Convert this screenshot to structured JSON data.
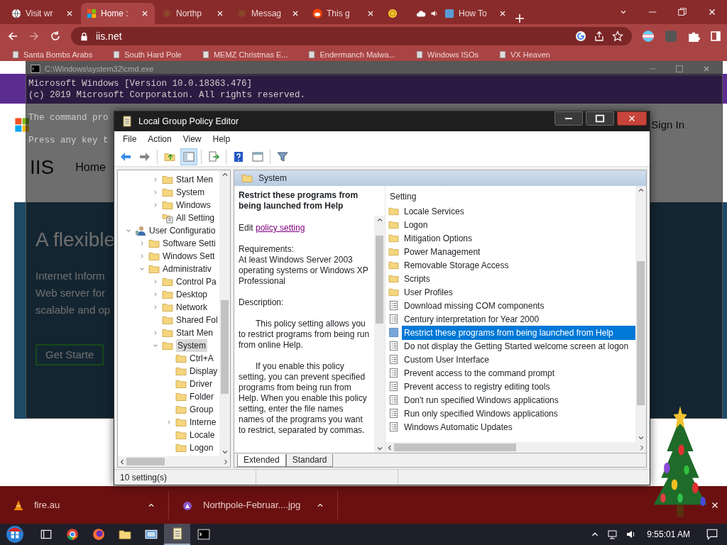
{
  "browser": {
    "tabs": [
      {
        "label": "Visit wr",
        "kind": "globe",
        "selected": false,
        "audio": false
      },
      {
        "label": "Home :",
        "kind": "windows",
        "selected": true,
        "audio": false
      },
      {
        "label": "Northp",
        "kind": "snowflake",
        "selected": false,
        "audio": false
      },
      {
        "label": "Messag",
        "kind": "snowflake",
        "selected": false,
        "audio": false
      },
      {
        "label": "This g",
        "kind": "reddit",
        "selected": false,
        "audio": false
      },
      {
        "kind": "coin",
        "selected": false,
        "audio": false
      },
      {
        "kind": "cloud",
        "selected": false,
        "audio": true
      },
      {
        "label": "How To",
        "kind": "tile",
        "selected": false,
        "audio": false
      }
    ],
    "address": "iis.net",
    "bookmarks": [
      "Santa Bombs Arabs",
      "South Hard Pole",
      "MEMZ Christmas E...",
      "Endermanch Malwa...",
      "Windows ISOs",
      "VX Heaven"
    ],
    "page": {
      "sign_in": "Sign In",
      "logo": "IIS",
      "nav": "Home",
      "hero_title": "A flexible",
      "hero_lines": [
        "Internet Inform",
        "Web server for",
        "scalable and op"
      ],
      "cta": "Get Starte"
    },
    "downloads": [
      {
        "name": "fire.au",
        "kind": "cone"
      },
      {
        "name": "Northpole-Februar....jpg",
        "kind": "image"
      }
    ]
  },
  "cmd": {
    "title": "C:\\Windows\\system32\\cmd.exe",
    "lines": [
      "Microsoft Windows [Version 10.0.18363.476]",
      "(c) 2019 Microsoft Corporation. All rights reserved.",
      "The command pro",
      "Press any key t"
    ]
  },
  "gpe": {
    "title": "Local Group Policy Editor",
    "menu": [
      "File",
      "Action",
      "View",
      "Help"
    ],
    "toolbar": [
      {
        "kind": "back",
        "pressed": false,
        "separator_before": false
      },
      {
        "kind": "forward",
        "pressed": false,
        "separator_before": false
      },
      {
        "kind": "folder-up",
        "pressed": false,
        "separator_before": true
      },
      {
        "kind": "tree-toggle",
        "pressed": true,
        "separator_before": false
      },
      {
        "kind": "export",
        "pressed": false,
        "separator_before": true
      },
      {
        "kind": "help",
        "pressed": false,
        "separator_before": true
      },
      {
        "kind": "view",
        "pressed": false,
        "separator_before": false
      },
      {
        "kind": "filter",
        "pressed": false,
        "separator_before": true
      }
    ],
    "tree": {
      "partial_items": [
        {
          "label": "Start Men",
          "kind": "folder",
          "expanded": false,
          "selected": false
        },
        {
          "label": "System",
          "kind": "folder",
          "expanded": false,
          "selected": false
        },
        {
          "label": "Windows",
          "kind": "folder",
          "expanded": false,
          "selected": false
        },
        {
          "label": "All Setting",
          "kind": "settings",
          "selected": false
        }
      ],
      "items": [
        {
          "label": "User Configuratio",
          "kind": "user",
          "expanded": true,
          "selected": false,
          "children": [
            {
              "label": "Software Setti",
              "kind": "folder",
              "expanded": false,
              "selected": false
            },
            {
              "label": "Windows Sett",
              "kind": "folder",
              "expanded": false,
              "selected": false
            },
            {
              "label": "Administrativ",
              "kind": "folder",
              "expanded": true,
              "selected": false,
              "children": [
                {
                  "label": "Control Pa",
                  "kind": "folder",
                  "expanded": false,
                  "selected": false
                },
                {
                  "label": "Desktop",
                  "kind": "folder",
                  "expanded": false,
                  "selected": false
                },
                {
                  "label": "Network",
                  "kind": "folder",
                  "expanded": false,
                  "selected": false
                },
                {
                  "label": "Shared Fol",
                  "kind": "folder",
                  "selected": false
                },
                {
                  "label": "Start Men",
                  "kind": "folder",
                  "expanded": false,
                  "selected": false
                },
                {
                  "label": "System",
                  "kind": "folder",
                  "expanded": true,
                  "selected": true,
                  "children": [
                    {
                      "label": "Ctrl+A",
                      "kind": "folder",
                      "selected": false
                    },
                    {
                      "label": "Display",
                      "kind": "folder",
                      "selected": false
                    },
                    {
                      "label": "Driver",
                      "kind": "folder",
                      "selected": false
                    },
                    {
                      "label": "Folder",
                      "kind": "folder",
                      "selected": false
                    },
                    {
                      "label": "Group",
                      "kind": "folder",
                      "selected": false
                    },
                    {
                      "label": "Interne",
                      "kind": "folder",
                      "expanded": false,
                      "selected": false
                    },
                    {
                      "label": "Locale",
                      "kind": "folder",
                      "selected": false
                    },
                    {
                      "label": "Logon",
                      "kind": "folder",
                      "selected": false
                    }
                  ]
                }
              ]
            }
          ]
        }
      ]
    },
    "header": "System",
    "description": {
      "title": "Restrict these programs from being launched from Help",
      "edit_prefix": "Edit",
      "edit_link": "policy setting",
      "requirements_label": "Requirements:",
      "requirements": "At least Windows Server 2003 operating systems or Windows XP Professional",
      "description_label": "Description:",
      "paragraphs": [
        "This policy setting allows you to restrict programs from being run from online Help.",
        "If you enable this policy setting, you can prevent specified programs from being run from Help. When you enable this policy setting, enter the file names names of the programs you want to restrict, separated by commas."
      ]
    },
    "list": {
      "column": "Setting",
      "items": [
        {
          "label": "Locale Services",
          "kind": "folder",
          "selected": false
        },
        {
          "label": "Logon",
          "kind": "folder",
          "selected": false
        },
        {
          "label": "Mitigation Options",
          "kind": "folder",
          "selected": false
        },
        {
          "label": "Power Management",
          "kind": "folder",
          "selected": false
        },
        {
          "label": "Removable Storage Access",
          "kind": "folder",
          "selected": false
        },
        {
          "label": "Scripts",
          "kind": "folder",
          "selected": false
        },
        {
          "label": "User Profiles",
          "kind": "folder",
          "selected": false
        },
        {
          "label": "Download missing COM components",
          "kind": "setting",
          "selected": false
        },
        {
          "label": "Century interpretation for Year 2000",
          "kind": "setting",
          "selected": false
        },
        {
          "label": "Restrict these programs from being launched from Help",
          "kind": "setting",
          "selected": true
        },
        {
          "label": "Do not display the Getting Started welcome screen at logon",
          "kind": "setting",
          "selected": false
        },
        {
          "label": "Custom User Interface",
          "kind": "setting",
          "selected": false
        },
        {
          "label": "Prevent access to the command prompt",
          "kind": "setting",
          "selected": false
        },
        {
          "label": "Prevent access to registry editing tools",
          "kind": "setting",
          "selected": false
        },
        {
          "label": "Don't run specified Windows applications",
          "kind": "setting",
          "selected": false
        },
        {
          "label": "Run only specified Windows applications",
          "kind": "setting",
          "selected": false
        },
        {
          "label": "Windows Automatic Updates",
          "kind": "setting",
          "selected": false
        }
      ]
    },
    "view_tabs": [
      {
        "label": "Extended",
        "selected": true
      },
      {
        "label": "Standard",
        "selected": false
      }
    ],
    "status": "10 setting(s)"
  },
  "taskbar": {
    "apps": [
      {
        "kind": "task-view",
        "active": false
      },
      {
        "kind": "chrome",
        "active": false
      },
      {
        "kind": "firefox",
        "active": false
      },
      {
        "kind": "explorer",
        "active": false
      },
      {
        "kind": "photos",
        "active": false
      },
      {
        "kind": "policy",
        "active": true
      },
      {
        "kind": "console",
        "active": false
      }
    ],
    "clock": "9:55:01 AM"
  }
}
